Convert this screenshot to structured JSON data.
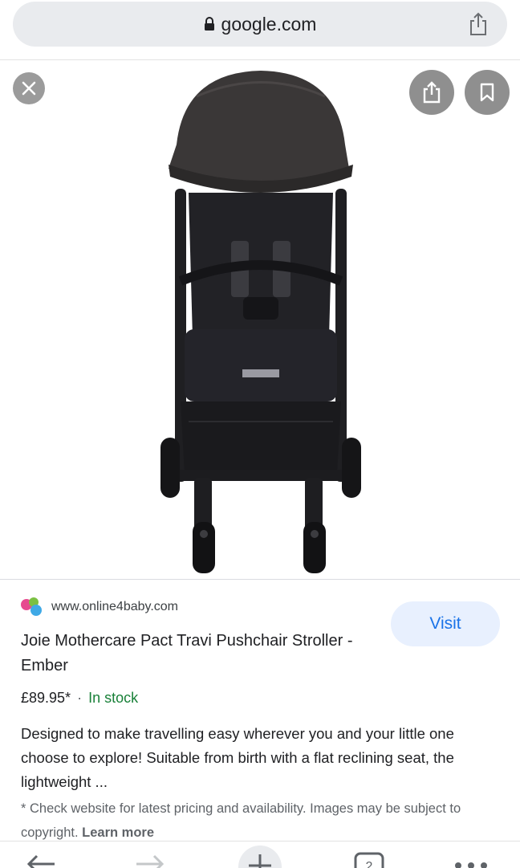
{
  "browser": {
    "url": "google.com",
    "icons": [
      "lock-icon",
      "share-icon"
    ]
  },
  "image_viewer": {
    "close_icon": "close-icon",
    "share_icon": "share-icon",
    "save_icon": "bookmark-icon"
  },
  "result": {
    "source": "www.online4baby.com",
    "visit_label": "Visit",
    "title": "Joie Mothercare Pact Travi Pushchair Stroller - Ember",
    "price": "£89.95*",
    "separator": "·",
    "stock": "In stock",
    "description": "Designed to make travelling easy wherever you and your little one choose to explore! Suitable from birth with a flat reclining seat, the lightweight ...",
    "note_text": "* Check website for latest pricing and availability. Images may be subject to copyright.",
    "note_link": "Learn more"
  },
  "colors": {
    "accent": "#1a73e8",
    "in_stock": "#188038",
    "visit_bg": "#e8f0fe"
  }
}
